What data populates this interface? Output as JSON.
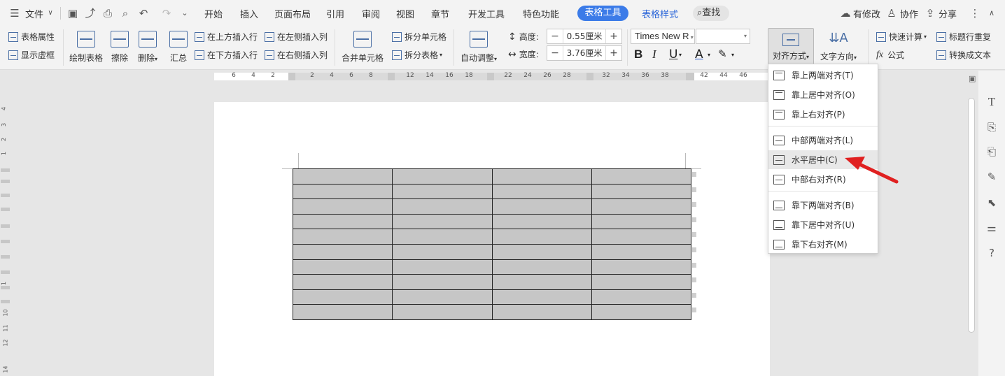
{
  "menubar": {
    "file_label": "文件",
    "tabs": [
      "开始",
      "插入",
      "页面布局",
      "引用",
      "审阅",
      "视图",
      "章节",
      "开发工具",
      "特色功能"
    ],
    "active_tab": "表格工具",
    "blue_tab": "表格样式",
    "search_label": "查找",
    "modified_label": "有修改",
    "collab_label": "协作",
    "share_label": "分享"
  },
  "ribbon": {
    "table_props": "表格属性",
    "show_gridlines": "显示虚框",
    "draw_table": "绘制表格",
    "erase": "擦除",
    "delete": "删除",
    "summary": "汇总",
    "insert_row_above": "在上方插入行",
    "insert_row_below": "在下方插入行",
    "insert_col_left": "在左侧插入列",
    "insert_col_right": "在右侧插入列",
    "merge_cells": "合并单元格",
    "split_cells": "拆分单元格",
    "split_table": "拆分表格",
    "auto_adjust": "自动调整",
    "height_label": "高度:",
    "height_value": "0.55厘米",
    "width_label": "宽度:",
    "width_value": "3.76厘米",
    "font_name": "Times New R",
    "align_label": "对齐方式",
    "text_direction": "文字方向",
    "quick_calc": "快速计算",
    "formula": "公式",
    "repeat_header": "标题行重复",
    "convert_text": "转换成文本"
  },
  "ruler": {
    "h_ticks": [
      "6",
      "4",
      "2",
      "2",
      "4",
      "6",
      "8",
      "12",
      "14",
      "16",
      "18",
      "22",
      "24",
      "26",
      "28",
      "32",
      "34",
      "36",
      "38",
      "42",
      "44",
      "46"
    ],
    "v_ticks": [
      "4",
      "3",
      "2",
      "1",
      "1",
      "10",
      "11",
      "12",
      "14"
    ]
  },
  "dropdown": {
    "items": [
      {
        "label": "靠上两端对齐(T)",
        "pos": "t"
      },
      {
        "label": "靠上居中对齐(O)",
        "pos": "t"
      },
      {
        "label": "靠上右对齐(P)",
        "pos": "t"
      },
      {
        "label": "中部两端对齐(L)",
        "pos": "m"
      },
      {
        "label": "水平居中(C)",
        "pos": "m"
      },
      {
        "label": "中部右对齐(R)",
        "pos": "m"
      },
      {
        "label": "靠下两端对齐(B)",
        "pos": "b"
      },
      {
        "label": "靠下居中对齐(U)",
        "pos": "b"
      },
      {
        "label": "靠下右对齐(M)",
        "pos": "b"
      }
    ],
    "highlighted": "水平居中(C)"
  },
  "table": {
    "rows": 10,
    "cols": 4
  },
  "colors": {
    "accent": "#3b7be8",
    "arrow": "#e02020",
    "cell_fill": "#c6c6c6"
  }
}
